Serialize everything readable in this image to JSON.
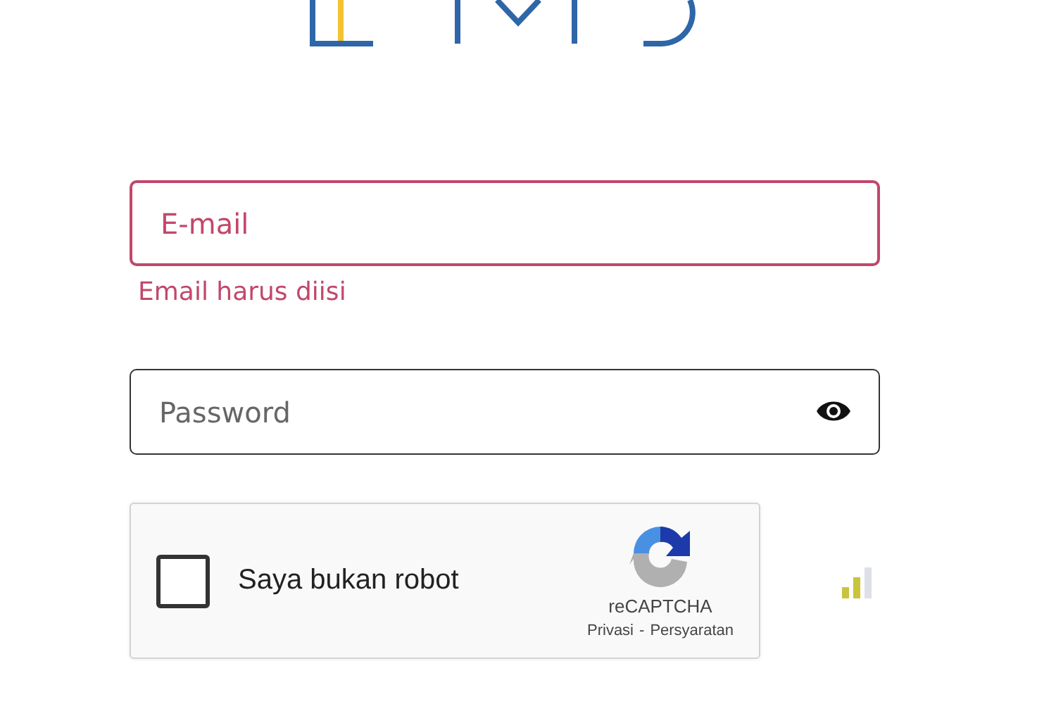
{
  "email": {
    "placeholder": "E-mail",
    "error": true,
    "error_message": "Email harus diisi"
  },
  "password": {
    "placeholder": "Password"
  },
  "captcha": {
    "label": "Saya bukan robot",
    "checked": false,
    "brand": "reCAPTCHA",
    "privacy": "Privasi",
    "separator": "-",
    "terms": "Persyaratan"
  }
}
